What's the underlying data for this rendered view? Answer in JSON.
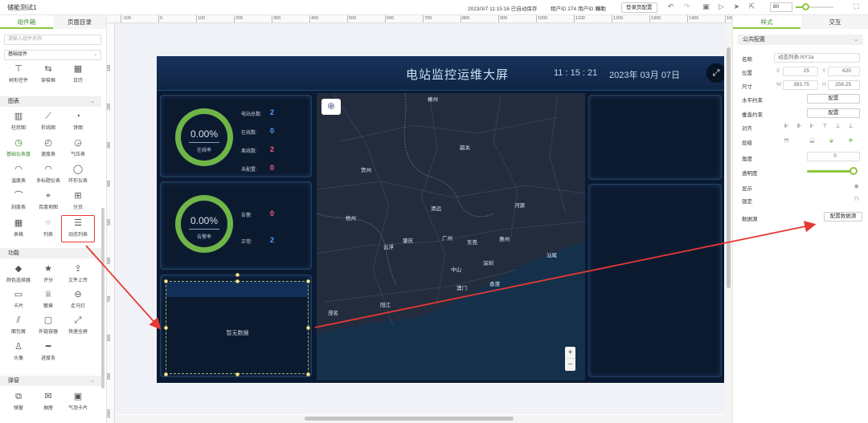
{
  "topbar": {
    "app_title": "储能测试1",
    "save_status": "2023/3/7 11:15:16 已自动保存",
    "tenant": "租户ID 274 用户ID 387",
    "help": "帮助",
    "login_config": "登录页配置",
    "zoom": "80"
  },
  "left_panel": {
    "tabs": [
      "组件箱",
      "页面目录"
    ],
    "search_placeholder": "请输入组件名称",
    "category": "基础组件",
    "row0": [
      "树形控件",
      "穿梭框",
      "日历"
    ],
    "sections": {
      "charts": "图表",
      "functions": "功能",
      "popups": "弹窗"
    },
    "charts_items": [
      "柱状图",
      "折线图",
      "饼图",
      "基础仪表盘",
      "速度表",
      "气压表",
      "温度表",
      "多标题仪表",
      "环形仪表",
      "刻度表",
      "百度地图",
      "分页",
      "表格",
      "列表",
      "动态列表"
    ],
    "function_items": [
      "颜色选择器",
      "评分",
      "文件上传",
      "卡片",
      "徽章",
      "走马灯",
      "面包屑",
      "外链容器",
      "快速全屏",
      "头像",
      "进度条"
    ],
    "popup_items": [
      "弹窗",
      "抽屉",
      "气泡卡片"
    ]
  },
  "ruler": {
    "h": [
      "-100",
      "0",
      "100",
      "200",
      "300",
      "400",
      "500",
      "600",
      "700",
      "800",
      "900",
      "1000",
      "1100",
      "1200",
      "1300",
      "1400",
      "1500"
    ],
    "v": [
      "100",
      "200",
      "300",
      "400",
      "500",
      "600",
      "700",
      "800",
      "900",
      "1000"
    ]
  },
  "screen": {
    "title": "电站监控运维大屏",
    "time": "11 : 15 : 21",
    "date": "2023年 03月 07日",
    "gauge1": {
      "value": "0.00%",
      "label": "在线率"
    },
    "gauge2": {
      "value": "0.00%",
      "label": "告警率"
    },
    "stats1": [
      {
        "label": "电站总数:",
        "value": "2",
        "color": "#4fa3ff"
      },
      {
        "label": "在线数:",
        "value": "0",
        "color": "#4fa3ff"
      },
      {
        "label": "离线数:",
        "value": "2",
        "color": "#ff5c7a"
      },
      {
        "label": "未配置:",
        "value": "0",
        "color": "#ff5c7a"
      }
    ],
    "stats2": [
      {
        "label": "告警:",
        "value": "0",
        "color": "#ff5c7a"
      },
      {
        "label": "正常:",
        "value": "2",
        "color": "#4fa3ff"
      }
    ],
    "list_empty": "暂无数据",
    "map_cities": [
      "郴州",
      "韶关",
      "贺州",
      "清远",
      "河源",
      "梧州",
      "广州",
      "惠州",
      "云浮",
      "肇庆",
      "东莞",
      "深圳",
      "汕尾",
      "中山",
      "澳门",
      "香港",
      "阳江",
      "茂名"
    ]
  },
  "right_panel": {
    "tabs": [
      "样式",
      "交互"
    ],
    "section": "公共配置",
    "name_label": "名称",
    "name_value": "动态列表-NY1a",
    "pos_label": "位置",
    "pos_x": "25",
    "pos_y": "620",
    "size_label": "尺寸",
    "size_w": "383.75",
    "size_h": "256.25",
    "h_constraint_label": "水平约束",
    "v_constraint_label": "垂直约束",
    "config_btn": "配置",
    "align_label": "对齐",
    "layer_label": "层级",
    "angle_label": "角度",
    "angle_value": "0",
    "opacity_label": "透明度",
    "opacity": 1,
    "display_label": "显示",
    "lock_label": "锁定",
    "datasource_label": "数据源",
    "datasource_btn": "配置数据源"
  },
  "colors": {
    "accent": "#8dc63f",
    "annotation": "#e53935",
    "screen_bg": "#0a1a33"
  }
}
